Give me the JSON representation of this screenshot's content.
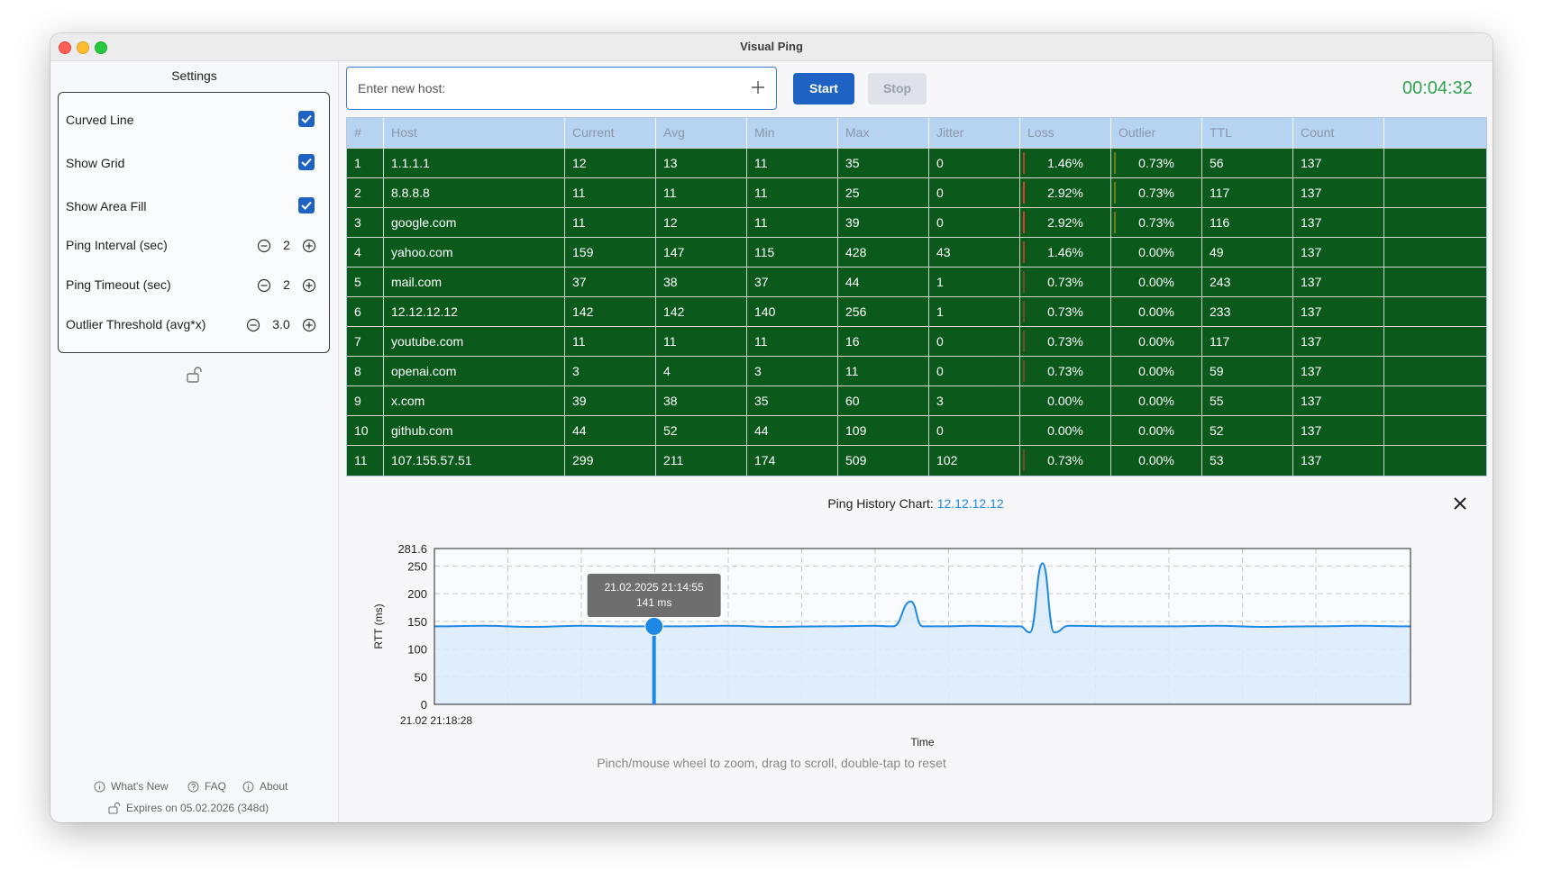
{
  "window": {
    "title": "Visual Ping"
  },
  "sidebar": {
    "title": "Settings",
    "options": [
      {
        "label": "Curved Line",
        "checked": true
      },
      {
        "label": "Show Grid",
        "checked": true
      },
      {
        "label": "Show Area Fill",
        "checked": true
      }
    ],
    "steppers": [
      {
        "label": "Ping Interval  (sec)",
        "value": "2"
      },
      {
        "label": "Ping Timeout (sec)",
        "value": "2"
      },
      {
        "label": "Outlier Threshold  (avg*x)",
        "value": "3.0"
      }
    ],
    "footer": {
      "whats_new": "What's New",
      "faq": "FAQ",
      "about": "About",
      "expires": "Expires on 05.02.2026 (348d)"
    }
  },
  "toolbar": {
    "host_placeholder": "Enter new host:",
    "start_label": "Start",
    "stop_label": "Stop",
    "timer": "00:04:32"
  },
  "table": {
    "columns": [
      "#",
      "Host",
      "Current",
      "Avg",
      "Min",
      "Max",
      "Jitter",
      "Loss",
      "Outlier",
      "TTL",
      "Count"
    ],
    "rows": [
      [
        "1",
        "1.1.1.1",
        "12",
        "13",
        "11",
        "35",
        "0",
        "1.46%",
        "0.73%",
        "56",
        "137"
      ],
      [
        "2",
        "8.8.8.8",
        "11",
        "11",
        "11",
        "25",
        "0",
        "2.92%",
        "0.73%",
        "117",
        "137"
      ],
      [
        "3",
        "google.com",
        "11",
        "12",
        "11",
        "39",
        "0",
        "2.92%",
        "0.73%",
        "116",
        "137"
      ],
      [
        "4",
        "yahoo.com",
        "159",
        "147",
        "115",
        "428",
        "43",
        "1.46%",
        "0.00%",
        "49",
        "137"
      ],
      [
        "5",
        "mail.com",
        "37",
        "38",
        "37",
        "44",
        "1",
        "0.73%",
        "0.00%",
        "243",
        "137"
      ],
      [
        "6",
        "12.12.12.12",
        "142",
        "142",
        "140",
        "256",
        "1",
        "0.73%",
        "0.00%",
        "233",
        "137"
      ],
      [
        "7",
        "youtube.com",
        "11",
        "11",
        "11",
        "16",
        "0",
        "0.73%",
        "0.00%",
        "117",
        "137"
      ],
      [
        "8",
        "openai.com",
        "3",
        "4",
        "3",
        "11",
        "0",
        "0.73%",
        "0.00%",
        "59",
        "137"
      ],
      [
        "9",
        "x.com",
        "39",
        "38",
        "35",
        "60",
        "3",
        "0.00%",
        "0.00%",
        "55",
        "137"
      ],
      [
        "10",
        "github.com",
        "44",
        "52",
        "44",
        "109",
        "0",
        "0.00%",
        "0.00%",
        "52",
        "137"
      ],
      [
        "11",
        "107.155.57.51",
        "299",
        "211",
        "174",
        "509",
        "102",
        "0.73%",
        "0.00%",
        "53",
        "137"
      ]
    ],
    "colors": {
      "row_bg": "#0b5a1c",
      "header_bg": "#b7d3f2",
      "loss_bar": "#e53935",
      "outlier_bar": "#d4a017"
    }
  },
  "chart": {
    "title_prefix": "Ping History Chart: ",
    "host": "12.12.12.12",
    "tooltip_time": "21.02.2025 21:14:55",
    "tooltip_value": "141 ms",
    "x_start_label": "21.02 21:18:28",
    "hint": "Pinch/mouse wheel to zoom, drag to scroll, double-tap to reset"
  },
  "chart_data": {
    "type": "area",
    "title": "Ping History Chart: 12.12.12.12",
    "xlabel": "Time",
    "ylabel": "RTT (ms)",
    "ylim": [
      0,
      281.6
    ],
    "y_ticks": [
      "0",
      "50",
      "100",
      "150",
      "200",
      "250",
      "281.6"
    ],
    "grid": true,
    "series": [
      {
        "name": "",
        "color": "#1e88e5",
        "x": [
          0,
          0.05,
          0.1,
          0.15,
          0.2,
          0.25,
          0.3,
          0.35,
          0.4,
          0.45,
          0.47,
          0.488,
          0.5,
          0.52,
          0.55,
          0.6,
          0.61,
          0.623,
          0.635,
          0.65,
          0.7,
          0.75,
          0.8,
          0.85,
          0.9,
          0.95,
          1.0
        ],
        "values": [
          141,
          142,
          140,
          142,
          141,
          141,
          142,
          140,
          141,
          142,
          141,
          186,
          141,
          141,
          142,
          141,
          130,
          255,
          130,
          142,
          141,
          141,
          142,
          140,
          141,
          142,
          141
        ]
      }
    ],
    "selected_point": {
      "x": 0.225,
      "y": 141
    }
  }
}
